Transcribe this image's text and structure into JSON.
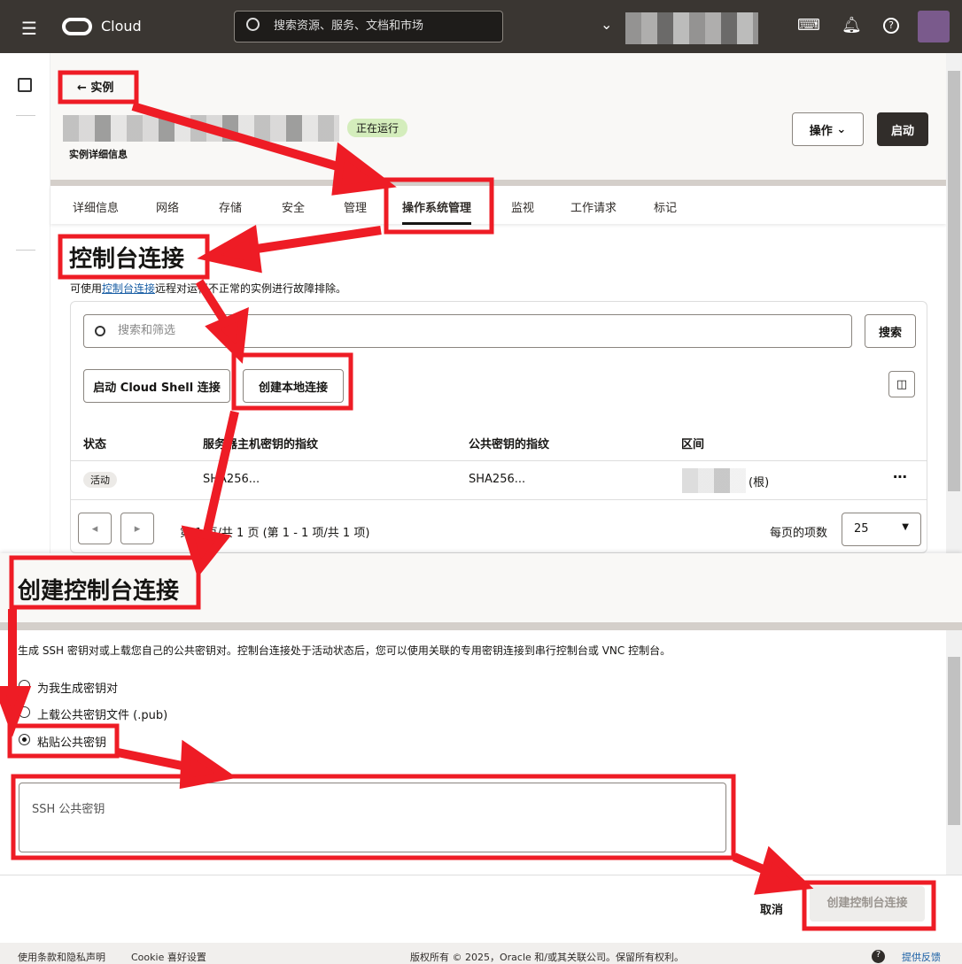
{
  "topbar": {
    "brand": "Cloud",
    "search_placeholder": "搜索资源、服务、文档和市场"
  },
  "header": {
    "back_label": "实例",
    "status": "正在运行",
    "subtitle": "实例详细信息",
    "actions_label": "操作",
    "start_label": "启动"
  },
  "tabs": [
    "详细信息",
    "网络",
    "存储",
    "安全",
    "管理",
    "操作系统管理",
    "监视",
    "工作请求",
    "标记"
  ],
  "section": {
    "title": "控制台连接",
    "desc_prefix": "可使用",
    "desc_link": "控制台连接",
    "desc_suffix": "远程对运行不正常的实例进行故障排除。",
    "search_placeholder": "搜索和筛选",
    "search_button": "搜索",
    "cloud_shell_button": "启动 Cloud Shell 连接",
    "local_button": "创建本地连接"
  },
  "table": {
    "headers": [
      "状态",
      "服务器主机密钥的指纹",
      "公共密钥的指纹",
      "区间"
    ],
    "rows": [
      {
        "status": "活动",
        "host_fp": "SHA256...",
        "pub_fp": "SHA256...",
        "compartment": "(根)"
      }
    ]
  },
  "pagination": {
    "text": "第 1 页/共 1 页 (第 1 - 1 项/共 1 项)",
    "per_page_label": "每页的项数",
    "per_page": "25"
  },
  "drawer": {
    "title": "创建控制台连接",
    "desc": "生成 SSH 密钥对或上载您自己的公共密钥对。控制台连接处于活动状态后，您可以使用关联的专用密钥连接到串行控制台或 VNC 控制台。",
    "options": [
      "为我生成密钥对",
      "上载公共密钥文件 (.pub)",
      "粘贴公共密钥"
    ],
    "selected": "粘贴公共密钥",
    "textarea_placeholder": "SSH 公共密钥",
    "cancel": "取消",
    "submit": "创建控制台连接"
  },
  "footer": {
    "terms": "使用条款和隐私声明",
    "cookie": "Cookie 喜好设置",
    "copyright": "版权所有 © 2025，Oracle 和/或其关联公司。保留所有权利。",
    "feedback": "提供反馈"
  },
  "colors": {
    "topbar": "#3a3632",
    "annotation": "#ee1c25",
    "status_badge": "#d4edbc",
    "primary_button": "#312d2a"
  }
}
